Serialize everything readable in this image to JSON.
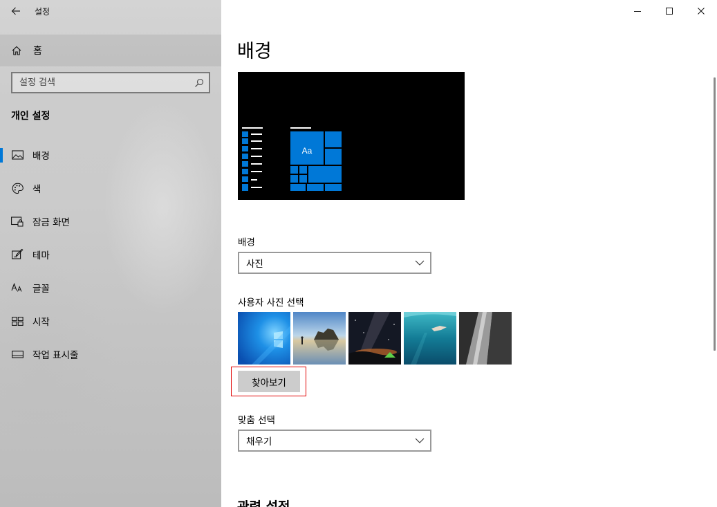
{
  "window": {
    "title": "설정",
    "controls": [
      "minimize",
      "maximize",
      "close"
    ]
  },
  "sidebar": {
    "home_label": "홈",
    "search": {
      "placeholder": "설정 검색",
      "value": ""
    },
    "section_heading": "개인 설정",
    "items": [
      {
        "label": "배경",
        "icon": "picture-icon",
        "selected": true
      },
      {
        "label": "색",
        "icon": "palette-icon",
        "selected": false
      },
      {
        "label": "잠금 화면",
        "icon": "lock-screen-icon",
        "selected": false
      },
      {
        "label": "테마",
        "icon": "theme-brush-icon",
        "selected": false
      },
      {
        "label": "글꼴",
        "icon": "font-icon",
        "selected": false
      },
      {
        "label": "시작",
        "icon": "start-icon",
        "selected": false
      },
      {
        "label": "작업 표시줄",
        "icon": "taskbar-icon",
        "selected": false
      }
    ]
  },
  "main": {
    "title": "배경",
    "preview": {
      "tile_text": "Aa",
      "tile_color": "#0078d7"
    },
    "background": {
      "label": "배경",
      "value": "사진"
    },
    "choose_picture": {
      "label": "사용자 사진 선택",
      "thumbnails": [
        "windows-logo",
        "beach-rocks",
        "milky-way-tent",
        "underwater-swimmer",
        "waterfall-cliff"
      ],
      "browse_label": "찾아보기"
    },
    "fit": {
      "label": "맞춤 선택",
      "value": "채우기"
    },
    "related_title": "관련 설정"
  },
  "colors": {
    "accent": "#0078d7",
    "highlight_border": "#e00000"
  }
}
